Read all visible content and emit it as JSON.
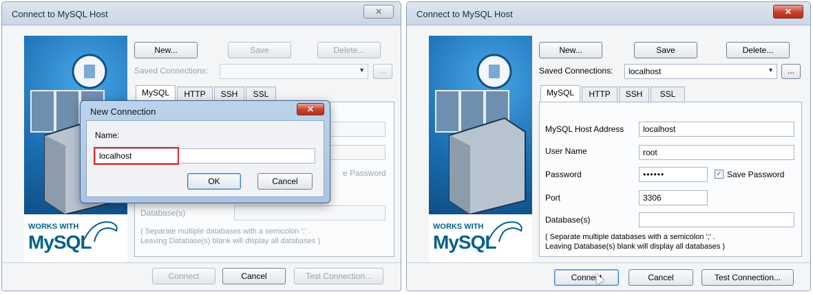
{
  "left": {
    "title": "Connect to MySQL Host",
    "close_glyph": "✕",
    "buttons": {
      "new": "New...",
      "save": "Save",
      "delete": "Delete..."
    },
    "saved_connections_label": "Saved Connections:",
    "tabs": [
      "MySQL",
      "HTTP",
      "SSH",
      "SSL"
    ],
    "save_password_fragment": "e Password",
    "database_label": "Database(s)",
    "note_line1": "( Separate multiple databases with a semicolon ';' .",
    "note_line2": "Leaving Database(s) blank will display all databases )",
    "footer": {
      "connect": "Connect",
      "cancel": "Cancel",
      "test": "Test Connection..."
    },
    "dialog": {
      "title": "New Connection",
      "close_glyph": "✕",
      "name_label": "Name:",
      "name_value": "localhost",
      "ok": "OK",
      "cancel": "Cancel"
    }
  },
  "right": {
    "title": "Connect to MySQL Host",
    "close_glyph": "✕",
    "buttons": {
      "new": "New...",
      "save": "Save",
      "delete": "Delete..."
    },
    "saved_connections_label": "Saved Connections:",
    "saved_connections_value": "localhost",
    "tabs": [
      "MySQL",
      "HTTP",
      "SSH",
      "SSL"
    ],
    "fields": {
      "host_label": "MySQL Host Address",
      "host_value": "localhost",
      "user_label": "User Name",
      "user_value": "root",
      "password_label": "Password",
      "password_value": "••••••",
      "save_password_label": "Save Password",
      "port_label": "Port",
      "port_value": "3306",
      "database_label": "Database(s)",
      "database_value": ""
    },
    "note_line1": "( Separate multiple databases with a semicolon ';' .",
    "note_line2": "Leaving Database(s) blank will display all databases )",
    "footer": {
      "connect": "Connect",
      "cancel": "Cancel",
      "test": "Test Connection..."
    }
  },
  "branding": {
    "works_with": "WORKS WITH",
    "mysql": "MySQL"
  },
  "colors": {
    "brand_blue": "#1b6fb2",
    "mysql_orange": "#e48e00",
    "mysql_blue": "#00618a",
    "highlight": "#e02a2a"
  }
}
